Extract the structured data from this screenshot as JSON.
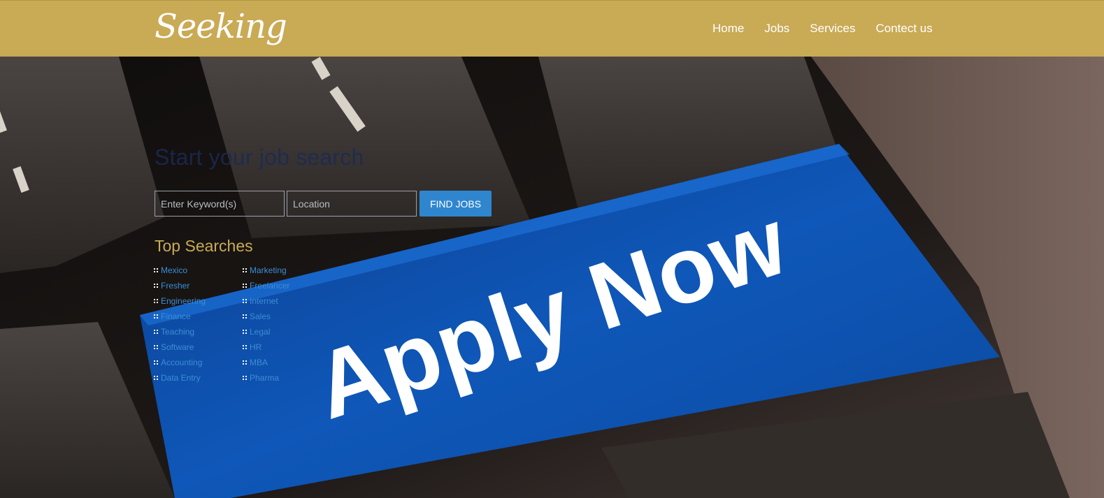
{
  "brand": {
    "logo_text": "Seeking"
  },
  "nav": {
    "items": [
      {
        "label": "Home"
      },
      {
        "label": "Jobs"
      },
      {
        "label": "Services"
      },
      {
        "label": "Contect us"
      }
    ]
  },
  "search": {
    "heading": "Start your job search",
    "keyword_placeholder": "Enter Keyword(s)",
    "location_placeholder": "Location",
    "button_label": "FIND JOBS"
  },
  "top_searches": {
    "title": "Top Searches",
    "column1": [
      "Mexico",
      "Fresher",
      "Engineering",
      "Finance",
      "Teaching",
      "Software",
      "Accounting",
      "Data Entry"
    ],
    "column2": [
      "Marketing",
      "Freelancer",
      "Internet",
      "Sales",
      "Legal",
      "HR",
      "MBA",
      "Pharma"
    ]
  },
  "hero": {
    "key_text": "Apply Now"
  },
  "colors": {
    "header": "#c9aa55",
    "accent_blue": "#2f86cf",
    "key_blue": "#0f57b8"
  }
}
